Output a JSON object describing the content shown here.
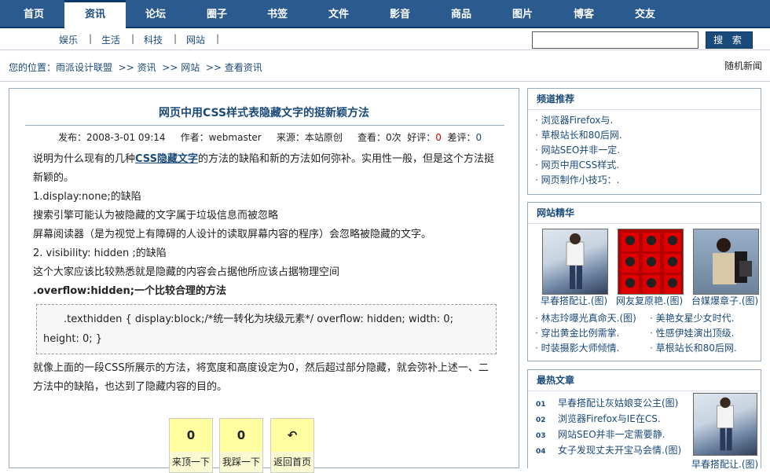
{
  "nav": {
    "items": [
      "首页",
      "资讯",
      "论坛",
      "圈子",
      "书签",
      "文件",
      "影音",
      "商品",
      "图片",
      "博客",
      "交友"
    ],
    "active": 1
  },
  "subnav": [
    "娱乐",
    "生活",
    "科技",
    "网站"
  ],
  "search": {
    "placeholder": "",
    "button": "搜 索"
  },
  "breadcrumb": {
    "prefix": "您的位置：",
    "site": "雨派设计联盟",
    "sep": ">>",
    "items": [
      "资讯",
      "网站",
      "查看资讯"
    ],
    "random": "随机新闻"
  },
  "article": {
    "title": "网页中用CSS样式表隐藏文字的挺新颖方法",
    "meta": {
      "published_label": "发布：",
      "published": "2008-3-01 09:14",
      "author_label": "作者：",
      "author": "webmaster",
      "source_label": "来源：",
      "source": "本站原创",
      "views_label": "查看：",
      "views": "0次",
      "good_label": "好评：",
      "good": "0",
      "bad_label": "差评：",
      "bad": "0"
    },
    "intro_a": "说明为什么现有的几种",
    "intro_link": "CSS隐藏文字",
    "intro_b": "的方法的缺陷和新的方法如何弥补。实用性一般，但是这个方法挺新颖的。",
    "p1": "1.display:none;的缺陷",
    "p2": "搜索引擎可能认为被隐藏的文字属于垃圾信息而被忽略",
    "p3": "屏幕阅读器（是为视觉上有障碍的人设计的读取屏幕内容的程序）会忽略被隐藏的文字。",
    "p4": "2. visibility: hidden ;的缺陷",
    "p5": "这个大家应该比较熟悉就是隐藏的内容会占据他所应该占据物理空间",
    "p6": ".overflow:hidden;一个比较合理的方法",
    "code": ".texthidden { display:block;/*统一转化为块级元素*/ overflow: hidden; width: 0; height: 0; }",
    "p7": "就像上面的一段CSS所展示的方法，将宽度和高度设定为0，然后超过部分隐藏，就会弥补上述一、二方法中的缺陷，也达到了隐藏内容的目的。"
  },
  "votes": [
    {
      "count": "0",
      "label": "来顶一下"
    },
    {
      "count": "0",
      "label": "我踩一下"
    },
    {
      "count": "↶",
      "label": "返回首页"
    }
  ],
  "channel": {
    "title": "频道推荐",
    "items": [
      "浏览器Firefox与.",
      "草根站长和80后网.",
      "网站SEO并非一定.",
      "网页中用CSS样式.",
      "网页制作小技巧：."
    ]
  },
  "featured": {
    "title": "网站精华",
    "captions": [
      "早春搭配让.(图)",
      "网友复原艳.(图)",
      "台媒爆章子.(图)"
    ],
    "left": [
      "林志玲曝光真命天.(图)",
      "穿出黄金比例需掌.",
      "时装摄影大师倾情."
    ],
    "right": [
      "美艳女星少女时代.",
      "性感伊娃演出顶级.",
      "草根站长和80后网."
    ]
  },
  "hot": {
    "title": "最热文章",
    "items": [
      {
        "n": "01",
        "t": "早春搭配让灰姑娘变公主(图)"
      },
      {
        "n": "02",
        "t": "浏览器Firefox与IE在CS."
      },
      {
        "n": "03",
        "t": "网站SEO并非一定需要静."
      },
      {
        "n": "04",
        "t": "女子发现丈夫开宝马会情.(图)"
      }
    ],
    "thumb_caption": "早春搭配让.(图)"
  },
  "colors": {
    "nav": "#2a5a8e",
    "link": "#1a4a7a",
    "accent_red": "#cc0000"
  }
}
